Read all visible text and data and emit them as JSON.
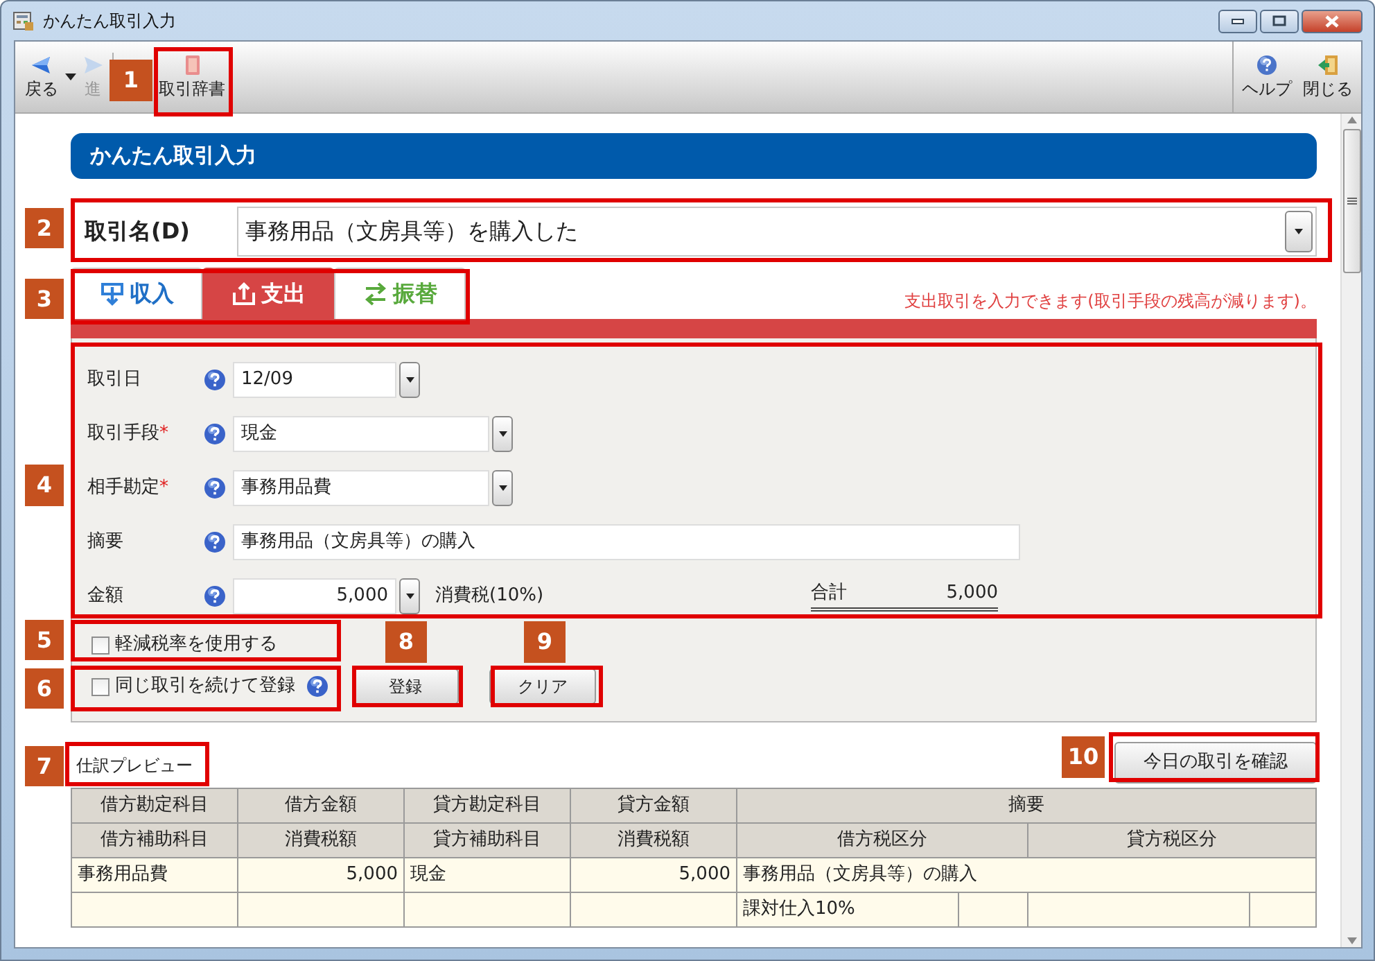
{
  "window": {
    "title": "かんたん取引入力"
  },
  "toolbar": {
    "left": [
      {
        "label": "戻る",
        "kind": "back",
        "disabled": false
      },
      {
        "label": "進",
        "kind": "forward",
        "disabled": true
      },
      {
        "label": "取引辞書",
        "kind": "dictionary",
        "disabled": false
      }
    ],
    "right": [
      {
        "label": "ヘルプ",
        "kind": "help",
        "disabled": false
      },
      {
        "label": "閉じる",
        "kind": "exit",
        "disabled": false
      }
    ]
  },
  "header": "かんたん取引入力",
  "trade_name": {
    "label": "取引名(D)",
    "value": "事務用品（文房具等）を購入した"
  },
  "tabs": [
    {
      "label": "収入",
      "kind": "income",
      "selected": false
    },
    {
      "label": "支出",
      "kind": "expense",
      "selected": true
    },
    {
      "label": "振替",
      "kind": "transfer",
      "selected": false
    }
  ],
  "tab_message": "支出取引を入力できます(取引手段の残高が減ります)。",
  "form": [
    {
      "label": "取引日",
      "kind": "dropdown",
      "value": "12/09"
    },
    {
      "label": "取引手段",
      "required_mark": "*",
      "kind": "dropdown",
      "value": "現金"
    },
    {
      "label": "相手勘定",
      "required_mark": "*",
      "kind": "dropdown",
      "value": "事務用品費"
    },
    {
      "label": "摘要",
      "kind": "text",
      "value": "事務用品（文房具等）の購入"
    },
    {
      "label": "金額",
      "kind": "amount",
      "value": "5,000"
    }
  ],
  "tax_label": "消費税(10%)",
  "total": {
    "label": "合計",
    "value": "5,000"
  },
  "options": [
    {
      "label": "軽減税率を使用する",
      "checked": false,
      "help": false
    },
    {
      "label": "同じ取引を続けて登録",
      "checked": false,
      "help": true
    }
  ],
  "buttons": [
    "登録",
    "クリア"
  ],
  "preview": {
    "title": "仕訳プレビュー",
    "confirm_button": "今日の取引を確認",
    "header_rows": [
      [
        {
          "text": "借方勘定科目"
        },
        {
          "text": "借方金額"
        },
        {
          "text": "貸方勘定科目"
        },
        {
          "text": "貸方金額"
        },
        {
          "text": "摘要"
        }
      ],
      [
        {
          "text": "借方補助科目"
        },
        {
          "text": "消費税額"
        },
        {
          "text": "貸方補助科目"
        },
        {
          "text": "消費税額"
        },
        {
          "text": "借方税区分"
        },
        {
          "text": "貸方税区分"
        }
      ]
    ],
    "rows": [
      [
        {
          "text": "事務用品費"
        },
        {
          "text": "5,000"
        },
        {
          "text": "現金"
        },
        {
          "text": "5,000"
        },
        {
          "text": "事務用品（文房具等）の購入"
        }
      ],
      [
        null,
        null,
        null,
        null,
        {
          "text": "課対仕入10%"
        },
        null,
        null,
        null
      ]
    ]
  },
  "annotations": [
    {
      "number": "1"
    },
    {
      "number": "2"
    },
    {
      "number": "3"
    },
    {
      "number": "4"
    },
    {
      "number": "5"
    },
    {
      "number": "6"
    },
    {
      "number": "7"
    },
    {
      "number": "8"
    },
    {
      "number": "9"
    },
    {
      "number": "10"
    }
  ]
}
